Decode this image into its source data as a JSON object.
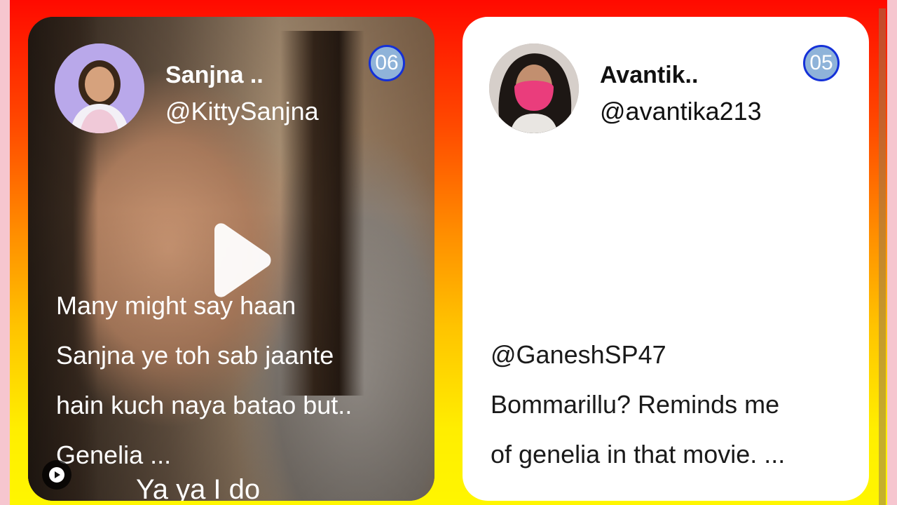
{
  "cards": [
    {
      "type": "video",
      "name": "Sanjna ..",
      "handle": "@KittySanjna",
      "count": "06",
      "text_lines": [
        "Many might say haan",
        "Sanjna ye toh sab jaante",
        "hain kuch naya batao but..",
        "Genelia ..."
      ],
      "video_caption": "Ya ya I do"
    },
    {
      "type": "text",
      "name": "Avantik..",
      "handle": "@avantika213",
      "count": "05",
      "text_lines": [
        "@GaneshSP47",
        "Bommarillu? Reminds me",
        "of genelia in that movie. ..."
      ]
    }
  ],
  "colors": {
    "badge_fill": "#8fb3d9",
    "badge_border": "#1431d8",
    "background_top": "#ff0a00",
    "background_bottom": "#fff600"
  },
  "icons": {
    "play": "play-icon",
    "mini_play": "mini-play-icon"
  }
}
